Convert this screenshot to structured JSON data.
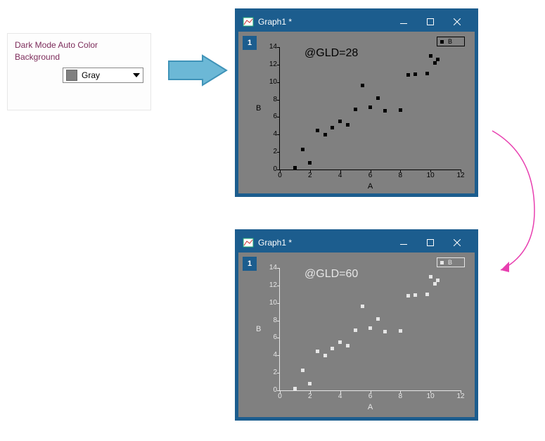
{
  "settings": {
    "label_line1": "Dark Mode Auto Color",
    "label_line2": "Background",
    "selected_value": "Gray",
    "swatch_color": "#808080"
  },
  "window": {
    "title": "Graph1 *",
    "layer_badge": "1"
  },
  "legend": {
    "series_name": "B"
  },
  "chart_data": [
    {
      "id": "top",
      "type": "scatter",
      "annotation": "@GLD=28",
      "xlabel": "A",
      "ylabel": "B",
      "xlim": [
        0,
        12
      ],
      "ylim": [
        0,
        14
      ],
      "xticks": [
        0,
        2,
        4,
        6,
        8,
        10,
        12
      ],
      "yticks": [
        0,
        2,
        4,
        6,
        8,
        10,
        12,
        14
      ],
      "marker_color": "#000000",
      "points": [
        {
          "x": 1.0,
          "y": 0.2
        },
        {
          "x": 1.5,
          "y": 2.3
        },
        {
          "x": 2.0,
          "y": 0.8
        },
        {
          "x": 2.5,
          "y": 4.5
        },
        {
          "x": 3.0,
          "y": 4.0
        },
        {
          "x": 3.5,
          "y": 4.8
        },
        {
          "x": 4.0,
          "y": 5.5
        },
        {
          "x": 4.5,
          "y": 5.1
        },
        {
          "x": 5.0,
          "y": 6.9
        },
        {
          "x": 5.5,
          "y": 9.6
        },
        {
          "x": 6.0,
          "y": 7.1
        },
        {
          "x": 6.5,
          "y": 8.2
        },
        {
          "x": 7.0,
          "y": 6.7
        },
        {
          "x": 8.0,
          "y": 6.8
        },
        {
          "x": 8.5,
          "y": 10.8
        },
        {
          "x": 9.0,
          "y": 10.9
        },
        {
          "x": 9.8,
          "y": 11.0
        },
        {
          "x": 10.0,
          "y": 13.0
        },
        {
          "x": 10.3,
          "y": 12.2
        },
        {
          "x": 10.5,
          "y": 12.6
        }
      ]
    },
    {
      "id": "bottom",
      "type": "scatter",
      "annotation": "@GLD=60",
      "xlabel": "A",
      "ylabel": "B",
      "xlim": [
        0,
        12
      ],
      "ylim": [
        0,
        14
      ],
      "xticks": [
        0,
        2,
        4,
        6,
        8,
        10,
        12
      ],
      "yticks": [
        0,
        2,
        4,
        6,
        8,
        10,
        12,
        14
      ],
      "marker_color": "#e6e6e6",
      "points": [
        {
          "x": 1.0,
          "y": 0.2
        },
        {
          "x": 1.5,
          "y": 2.3
        },
        {
          "x": 2.0,
          "y": 0.8
        },
        {
          "x": 2.5,
          "y": 4.5
        },
        {
          "x": 3.0,
          "y": 4.0
        },
        {
          "x": 3.5,
          "y": 4.8
        },
        {
          "x": 4.0,
          "y": 5.5
        },
        {
          "x": 4.5,
          "y": 5.1
        },
        {
          "x": 5.0,
          "y": 6.9
        },
        {
          "x": 5.5,
          "y": 9.6
        },
        {
          "x": 6.0,
          "y": 7.1
        },
        {
          "x": 6.5,
          "y": 8.2
        },
        {
          "x": 7.0,
          "y": 6.7
        },
        {
          "x": 8.0,
          "y": 6.8
        },
        {
          "x": 8.5,
          "y": 10.8
        },
        {
          "x": 9.0,
          "y": 10.9
        },
        {
          "x": 9.8,
          "y": 11.0
        },
        {
          "x": 10.0,
          "y": 13.0
        },
        {
          "x": 10.3,
          "y": 12.2
        },
        {
          "x": 10.5,
          "y": 12.6
        }
      ]
    }
  ]
}
